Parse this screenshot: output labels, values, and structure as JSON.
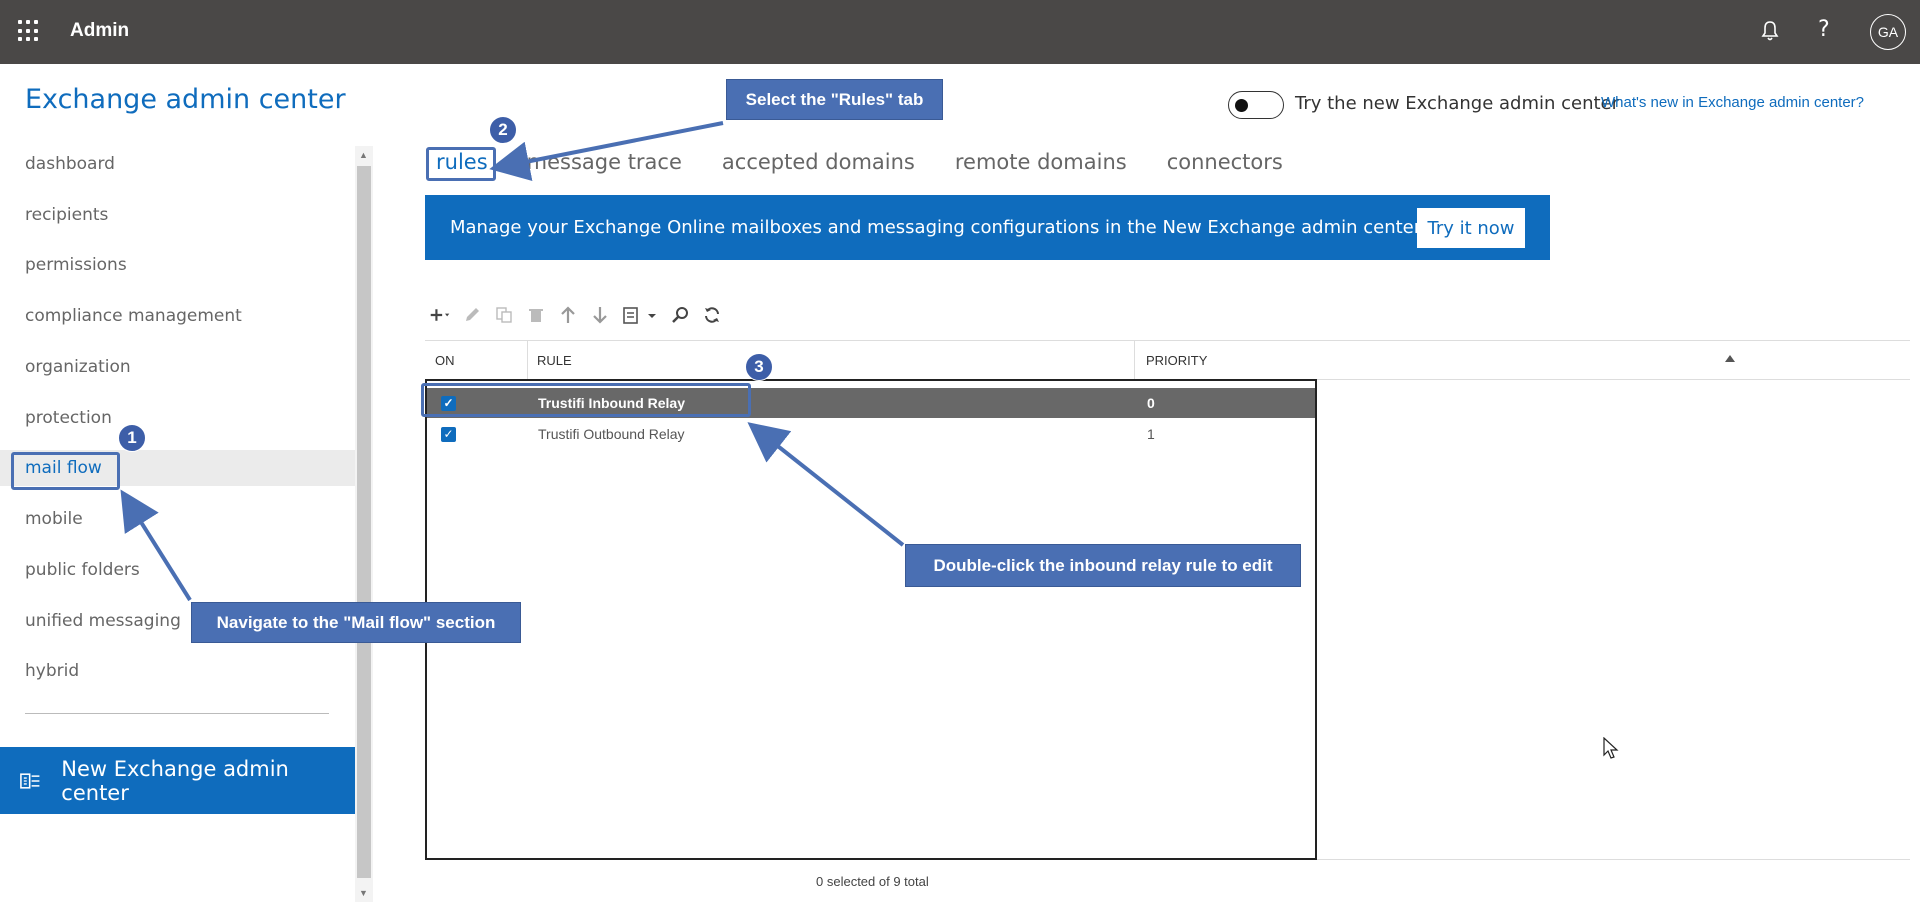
{
  "topbar": {
    "app_title": "Admin",
    "avatar_initials": "GA",
    "help_glyph": "?"
  },
  "header": {
    "title": "Exchange admin center",
    "toggle_label": "Try the new Exchange admin center",
    "whats_new_link": "What's new in Exchange admin center?"
  },
  "nav": {
    "items": [
      {
        "label": "dashboard"
      },
      {
        "label": "recipients"
      },
      {
        "label": "permissions"
      },
      {
        "label": "compliance management"
      },
      {
        "label": "organization"
      },
      {
        "label": "protection"
      },
      {
        "label": "mail flow",
        "active": true
      },
      {
        "label": "mobile"
      },
      {
        "label": "public folders"
      },
      {
        "label": "unified messaging"
      },
      {
        "label": "hybrid"
      }
    ],
    "new_eac_label": "New Exchange admin center"
  },
  "tabs": [
    {
      "label": "rules",
      "active": true
    },
    {
      "label": "message trace"
    },
    {
      "label": "accepted domains"
    },
    {
      "label": "remote domains"
    },
    {
      "label": "connectors"
    }
  ],
  "banner": {
    "text": "Manage your Exchange Online mailboxes and messaging configurations in the New Exchange admin center.",
    "button": "Try it now"
  },
  "toolbar": {
    "icons": [
      "add-icon",
      "edit-icon",
      "copy-icon",
      "delete-icon",
      "move-up-icon",
      "move-down-icon",
      "export-icon",
      "search-icon",
      "refresh-icon"
    ]
  },
  "grid": {
    "columns": {
      "on": "ON",
      "rule": "RULE",
      "priority": "PRIORITY"
    },
    "rows": [
      {
        "on": true,
        "rule": "Trustifi Inbound Relay",
        "priority": "0",
        "selected": true
      },
      {
        "on": true,
        "rule": "Trustifi Outbound Relay",
        "priority": "1",
        "selected": false
      }
    ],
    "count_text": "0 selected of 9 total"
  },
  "annotations": {
    "step1": {
      "number": "1",
      "text": "Navigate to the \"Mail flow\" section"
    },
    "step2": {
      "number": "2",
      "text": "Select the \"Rules\" tab"
    },
    "step3": {
      "number": "3",
      "text": "Double-click the inbound relay rule to edit"
    }
  },
  "colors": {
    "accent": "#0f6cbd",
    "topbar": "#4a4847",
    "callout": "#4a6fb3",
    "selected_row": "#686868"
  }
}
